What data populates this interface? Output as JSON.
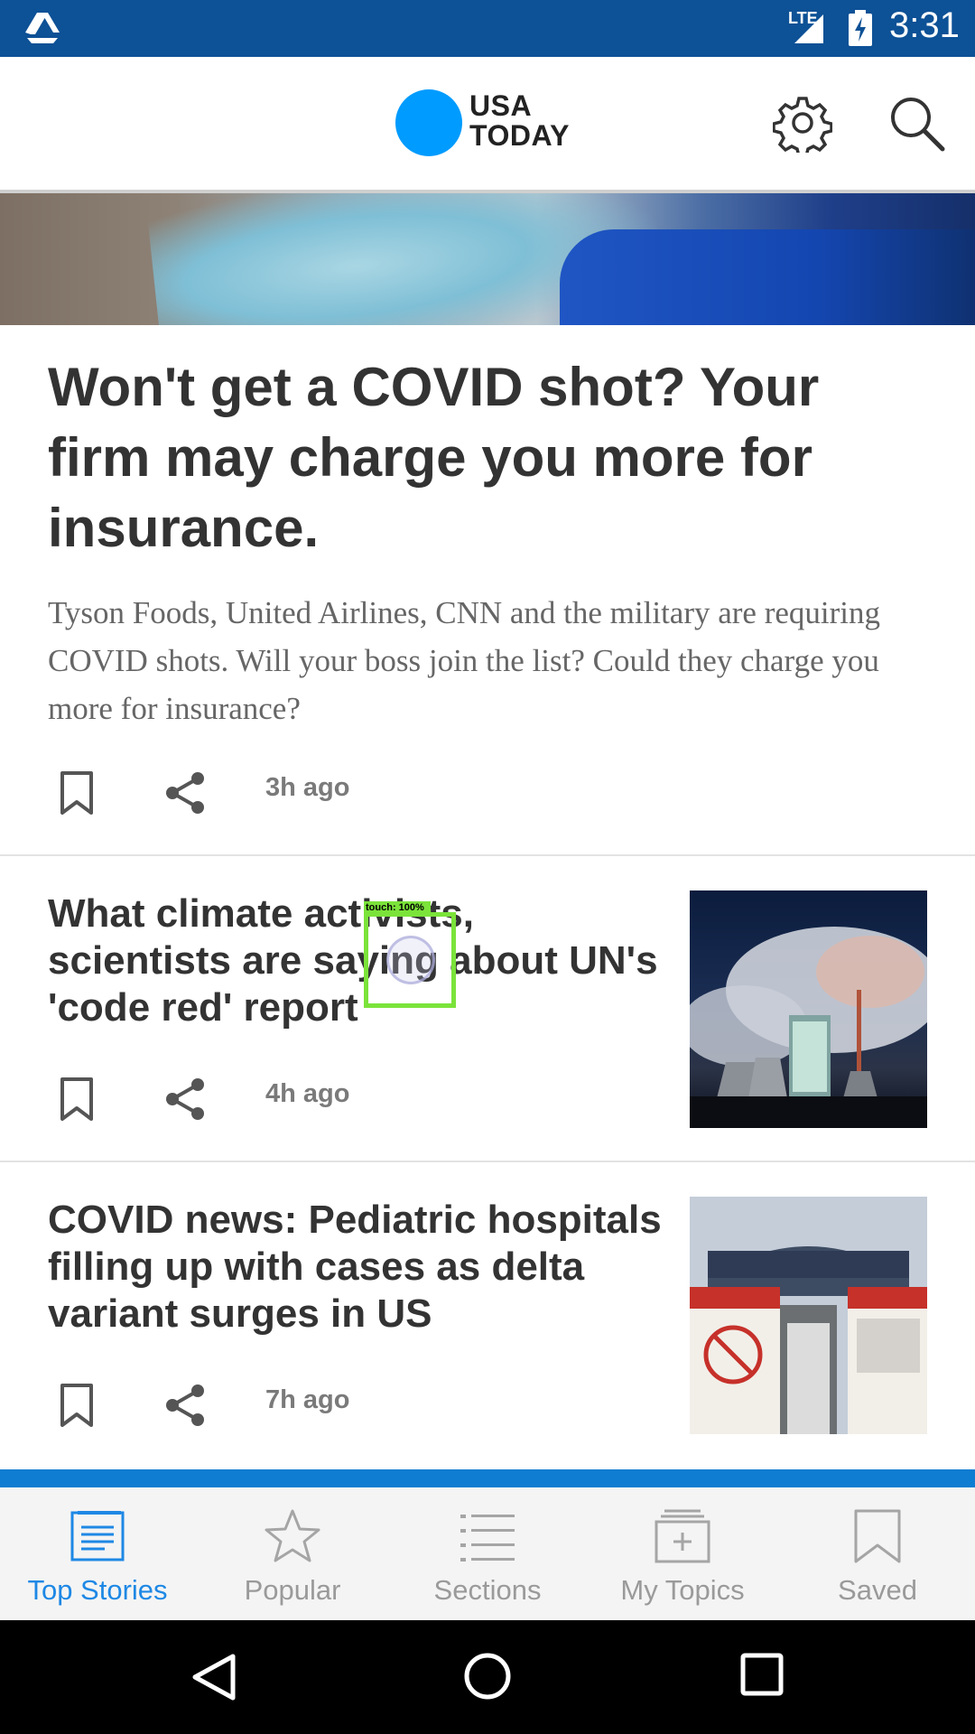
{
  "status_bar": {
    "network": "LTE",
    "time": "3:31",
    "icons": [
      "drive-icon",
      "signal-icon",
      "battery-charging-icon"
    ]
  },
  "header": {
    "logo_line1": "USA",
    "logo_line2": "TODAY",
    "brand_color": "#009bff",
    "icons": [
      "gear-icon",
      "search-icon"
    ]
  },
  "lead_story": {
    "title": "Won't get a COVID shot? Your firm may charge you more for insurance.",
    "summary": "Tyson Foods, United Airlines, CNN and the military are requiring COVID shots. Will your boss join the list? Could they charge you more for insurance?",
    "time": "3h ago"
  },
  "stories": [
    {
      "title": "What climate activists, scientists are saying about UN's 'code red' report",
      "time": "4h ago"
    },
    {
      "title": "COVID news: Pediatric hospitals filling up with cases as delta variant surges in US",
      "time": "7h ago"
    }
  ],
  "touch_overlay": {
    "label": "touch: 100%"
  },
  "bottom_nav": {
    "active_color": "#1e88e5",
    "items": [
      {
        "label": "Top Stories",
        "icon": "newspaper-icon",
        "active": true
      },
      {
        "label": "Popular",
        "icon": "star-icon",
        "active": false
      },
      {
        "label": "Sections",
        "icon": "list-icon",
        "active": false
      },
      {
        "label": "My Topics",
        "icon": "add-folder-icon",
        "active": false
      },
      {
        "label": "Saved",
        "icon": "bookmark-icon",
        "active": false
      }
    ]
  },
  "system_nav": {
    "icons": [
      "back-icon",
      "home-icon",
      "recents-icon"
    ]
  }
}
